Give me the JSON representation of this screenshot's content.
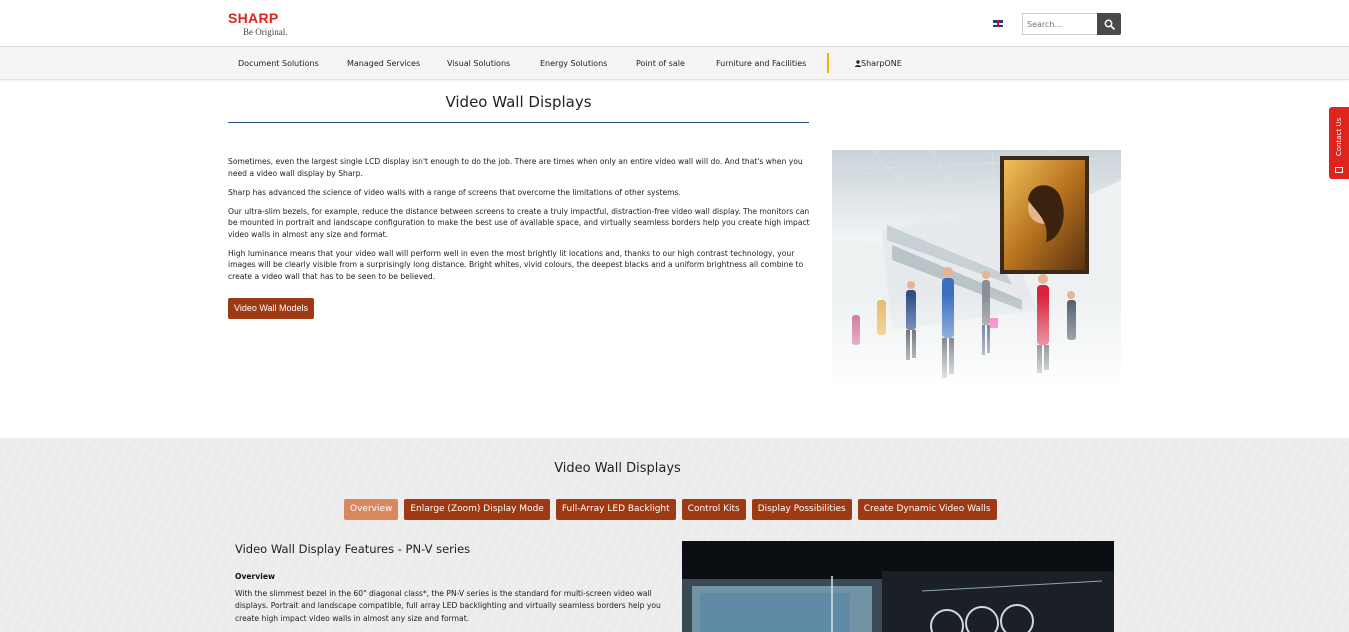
{
  "header": {
    "logo_name": "SHARP",
    "logo_tagline": "Be Original.",
    "language_icon": "uk-flag-icon",
    "search_placeholder": "Search...",
    "search_icon": "search-icon"
  },
  "nav": {
    "items": [
      "Document Solutions",
      "Managed Services",
      "Visual Solutions",
      "Energy Solutions",
      "Point of sale",
      "Furniture and Facilities"
    ],
    "account_label": "SharpONE",
    "account_icon": "user-icon"
  },
  "contact_tab": {
    "label": "Contact Us",
    "icon": "mail-icon"
  },
  "main": {
    "title": "Video Wall Displays",
    "paragraphs": [
      "Sometimes, even the largest single LCD display isn't enough to do the job. There are times when only an entire video wall will do. And that's when you need a video wall display by Sharp.",
      "Sharp has advanced the science of video walls with a range of screens that overcome the limitations of other systems.",
      "Our ultra-slim bezels, for example, reduce the distance between screens to create a truly impactful, distraction-free video wall display. The monitors can be mounted in portrait and landscape configuration to make the best use of available space, and virtually seamless borders help you create high impact video walls in almost any size and format.",
      "High luminance means that your video wall will perform well in even the most brightly lit locations and, thanks to our high contrast technology, your images will be clearly visible from a surprisingly long distance. Bright whites, vivid colours, the deepest blacks and a uniform brightness all combine to create a video wall that has to be seen to be believed."
    ],
    "models_button": "Video Wall Models"
  },
  "lower": {
    "title": "Video Wall Displays",
    "tabs": [
      "Overview",
      "Enlarge (Zoom) Display Mode",
      "Full-Array LED Backlight",
      "Control Kits",
      "Display Possibilities",
      "Create Dynamic Video Walls"
    ],
    "active_tab": "Overview",
    "features_heading": "Video Wall Display Features - PN-V series",
    "overview_label": "Overview",
    "overview_text": "With the slimmest bezel in the 60\" diagonal class*, the PN-V series is the standard for multi-screen video wall displays. Portrait and landscape compatible, full array LED backlighting and virtually seamless borders help you create high impact video walls in almost any size and format."
  },
  "colors": {
    "brand_red": "#e0231c",
    "button_brown": "#9d3a14",
    "active_tab": "#d9875f",
    "title_rule": "#2b4f8a",
    "nav_divider": "#f0b400"
  }
}
